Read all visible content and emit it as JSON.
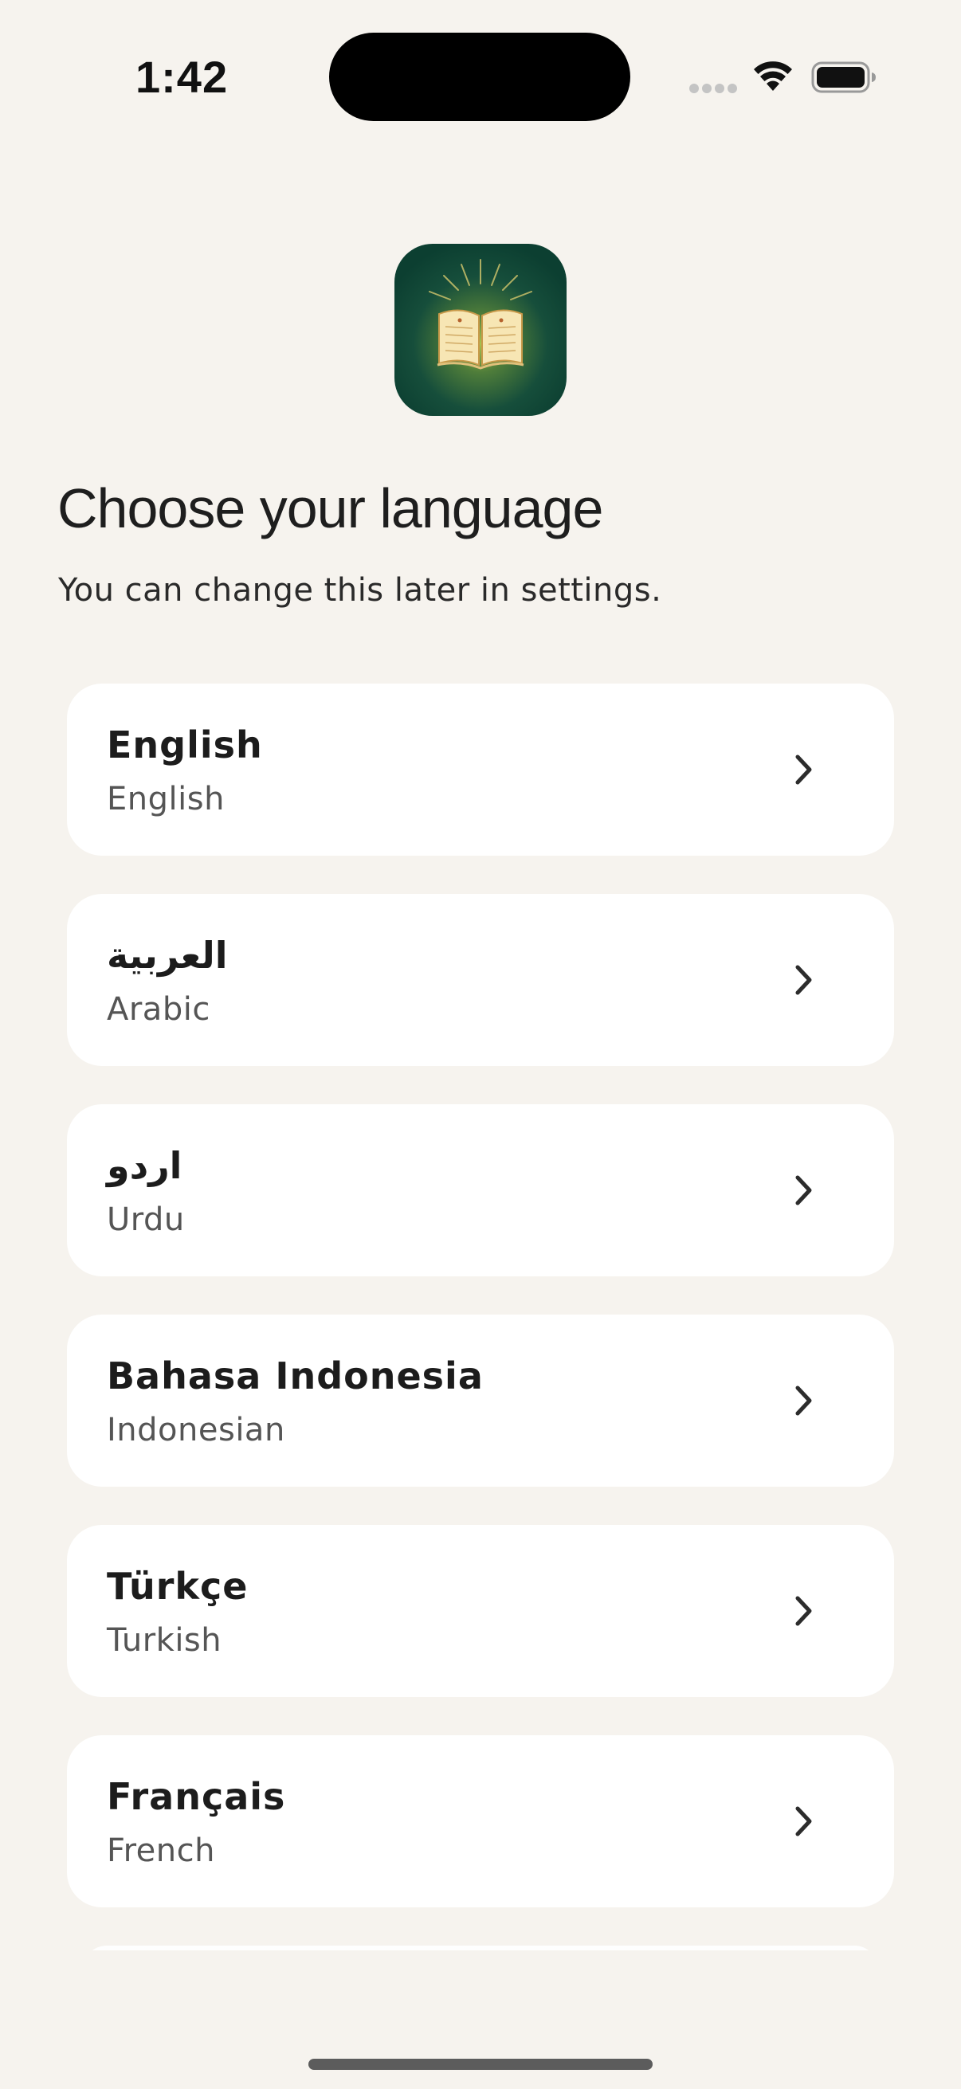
{
  "status_bar": {
    "time": "1:42",
    "signal_icon": "signal-dots-icon",
    "wifi_icon": "wifi-icon",
    "battery_icon": "battery-icon"
  },
  "app_icon": {
    "name": "open-book-icon",
    "colors": {
      "background": "#0f4a3a",
      "glow": "#9fbf4a",
      "book": "#f6e3b0"
    }
  },
  "header": {
    "title": "Choose your language",
    "subtitle": "You can change this later in settings."
  },
  "languages": [
    {
      "native": "English",
      "english": "English"
    },
    {
      "native": "العربية",
      "english": "Arabic"
    },
    {
      "native": "اردو",
      "english": "Urdu"
    },
    {
      "native": "Bahasa Indonesia",
      "english": "Indonesian"
    },
    {
      "native": "Türkçe",
      "english": "Turkish"
    },
    {
      "native": "Français",
      "english": "French"
    }
  ],
  "colors": {
    "page_background": "#f6f3ee",
    "card_background": "#ffffff",
    "primary_text": "#1c1c1c",
    "secondary_text": "#555555"
  }
}
